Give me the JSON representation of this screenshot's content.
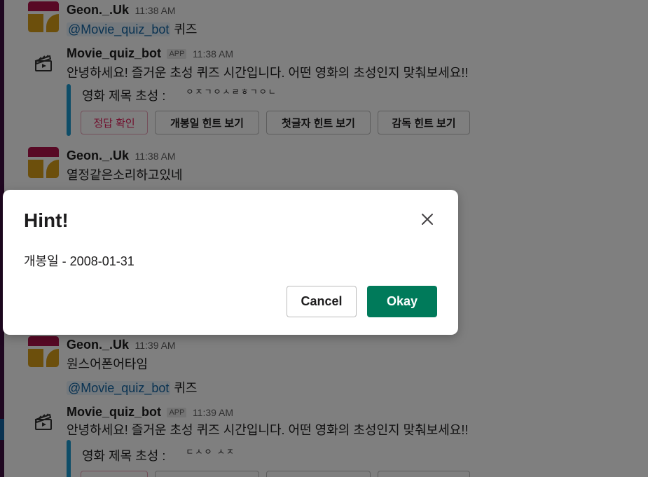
{
  "messages": [
    {
      "author": "Geon._.Uk",
      "time": "11:38 AM",
      "mention": "@Movie_quiz_bot",
      "text": "퀴즈"
    },
    {
      "author": "Movie_quiz_bot",
      "badge": "APP",
      "time": "11:38 AM",
      "text": "안녕하세요! 즐거운 초성 퀴즈 시간입니다. 어떤 영화의 초성인지 맞춰보세요!!",
      "attachment_label": "영화 제목 초성 :",
      "chosung": "ㅇㅈㄱㅇㅅㄹㅎㄱㅇㄴ"
    },
    {
      "author": "Geon._.Uk",
      "time": "11:38 AM",
      "text": "열정같은소리하고있네"
    },
    {
      "author": "Geon._.Uk",
      "time": "11:39 AM",
      "text": "원스어폰어타임",
      "mention": "@Movie_quiz_bot",
      "text2": "퀴즈"
    },
    {
      "author": "Movie_quiz_bot",
      "badge": "APP",
      "time": "11:39 AM",
      "text": "안녕하세요! 즐거운 초성 퀴즈 시간입니다. 어떤 영화의 초성인지 맞춰보세요!!",
      "attachment_label": "영화 제목 초성 :",
      "chosung": "ㄷㅅㅇ ㅅㅈ"
    }
  ],
  "buttons": {
    "answer": "정답 확인",
    "release_hint": "개봉일 힌트 보기",
    "first_letter_hint": "첫글자 힌트 보기",
    "director_hint": "감독 힌트 보기"
  },
  "modal": {
    "title": "Hint!",
    "body": "개봉일 - 2008-01-31",
    "cancel": "Cancel",
    "okay": "Okay"
  },
  "colors": {
    "sidebar": "#3f0e40",
    "accent_blue": "#1d9bd1",
    "okay_green": "#007a5a",
    "danger": "#e01e5a"
  },
  "icons": {
    "close": "close-icon",
    "bot_avatar": "clapperboard-icon"
  }
}
